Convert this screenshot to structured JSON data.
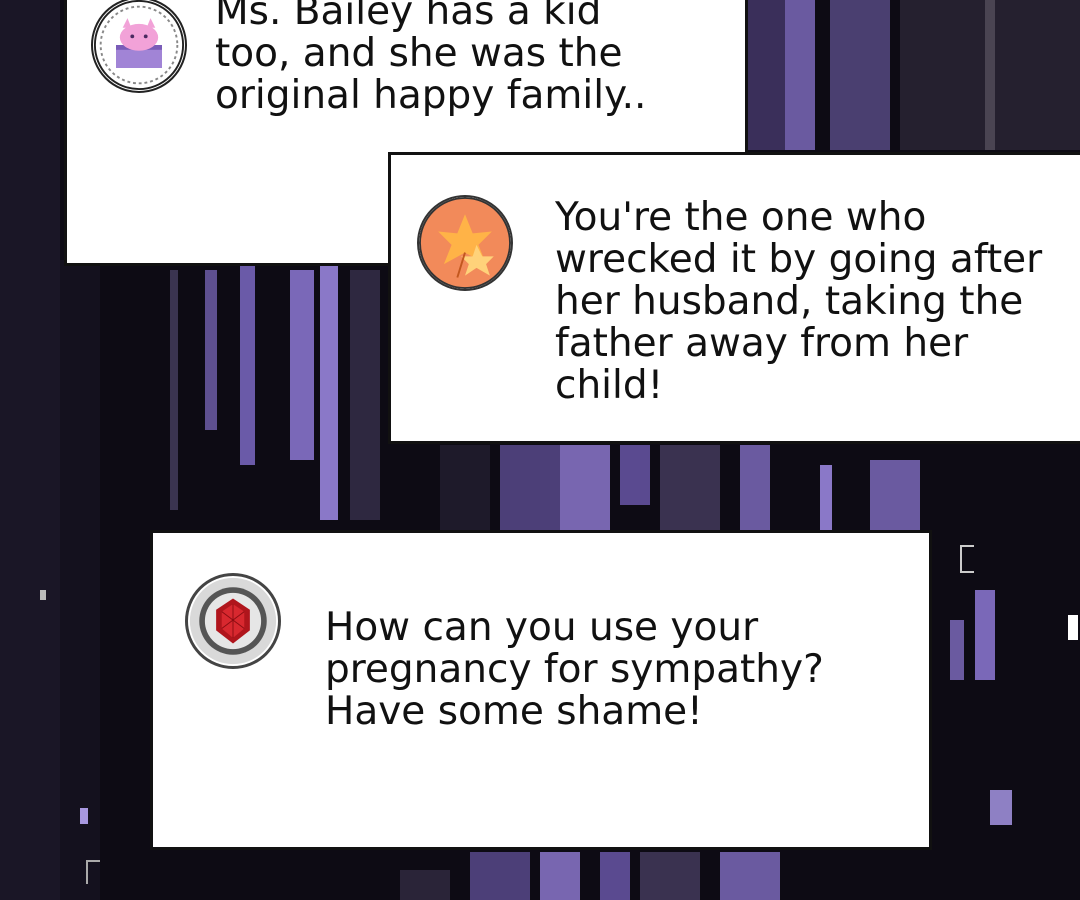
{
  "messages": [
    {
      "avatar_icon": "purple-cat-in-box-icon",
      "text": "Ms. Bailey has a kid\ntoo, and she was the\noriginal happy family.."
    },
    {
      "avatar_icon": "autumn-maple-leaves-icon",
      "text": "You're the one who\nwrecked it by going after\nher husband, taking the\nfather away from her\nchild!"
    },
    {
      "avatar_icon": "red-gem-emblem-icon",
      "text": "How can you use your\npregnancy for sympathy?\nHave some shame!"
    }
  ],
  "colors": {
    "background": "#0d0b14",
    "glitch_purple": "#7a68b8",
    "bubble": "#ffffff",
    "text": "#111111"
  }
}
